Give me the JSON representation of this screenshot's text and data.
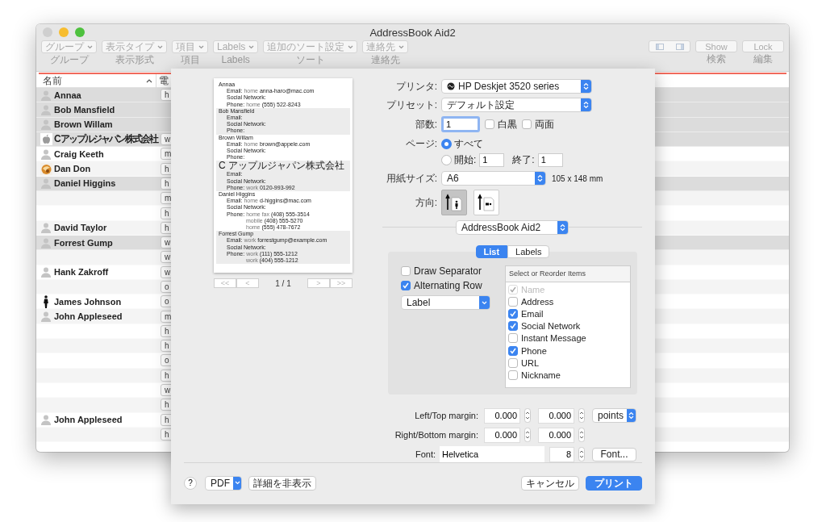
{
  "window": {
    "title": "AddressBook Aid2"
  },
  "toolbar": {
    "popups": [
      {
        "label": "グループ",
        "caption": "グループ",
        "disabled": true
      },
      {
        "label": "表示タイプ",
        "caption": "表示形式",
        "disabled": true
      },
      {
        "label": "項目",
        "caption": "項目",
        "disabled": true
      },
      {
        "label": "Labels",
        "caption": "Labels",
        "disabled": true
      },
      {
        "label": "追加のソート設定",
        "caption": "ソート",
        "disabled": true
      },
      {
        "label": "連絡先",
        "caption": "連絡先",
        "disabled": true
      }
    ],
    "buttons": [
      {
        "label": "Show",
        "caption": "検索",
        "disabled": true
      },
      {
        "label": "Lock",
        "caption": "編集",
        "disabled": true
      }
    ]
  },
  "table": {
    "columns": [
      "名前",
      "電"
    ],
    "rows": [
      {
        "name": "Annaa",
        "kind": "person",
        "highlighted": true,
        "phone": "h"
      },
      {
        "name": "Bob Mansfield",
        "kind": "person",
        "highlighted": true
      },
      {
        "name": "Brown Willam",
        "kind": "person",
        "highlighted": true
      },
      {
        "name": "C アップルジャパン株式会社",
        "kind": "company",
        "highlighted": true,
        "phone": "w"
      },
      {
        "name": "Craig Keeth",
        "kind": "person",
        "highlighted": false,
        "phone": "m"
      },
      {
        "name": "Dan Don",
        "highlighted": false,
        "phone": "h"
      },
      {
        "name": "Daniel Higgins",
        "kind": "person",
        "highlighted": true,
        "phone": "h"
      },
      {
        "highlighted": false,
        "phone": "m"
      },
      {
        "highlighted": false,
        "phone": "h"
      },
      {
        "name": "David Taylor",
        "kind": "person",
        "highlighted": false,
        "phone": "h"
      },
      {
        "name": "Forrest Gump",
        "kind": "person",
        "highlighted": true,
        "phone": "w"
      },
      {
        "highlighted": false,
        "phone": "w"
      },
      {
        "name": "Hank Zakroff",
        "kind": "person",
        "highlighted": false,
        "phone": "w"
      },
      {
        "highlighted": false,
        "phone": "o"
      },
      {
        "name": "James Johnson",
        "kind": "figure",
        "highlighted": false,
        "phone": "o"
      },
      {
        "name": "John Appleseed",
        "kind": "person",
        "highlighted": false,
        "phone": "m"
      },
      {
        "highlighted": false,
        "phone": "h"
      },
      {
        "highlighted": false,
        "phone": "h"
      },
      {
        "highlighted": false,
        "phone": "o"
      },
      {
        "highlighted": false,
        "phone": "h"
      },
      {
        "highlighted": false,
        "phone": "w"
      },
      {
        "highlighted": false,
        "phone": "h"
      },
      {
        "name": "John Appleseed",
        "kind": "person",
        "highlighted": false,
        "phone": "h"
      },
      {
        "highlighted": false,
        "phone": "h"
      }
    ]
  },
  "print": {
    "preview": [
      {
        "name": "Annaa",
        "shaded": false,
        "lines": [
          {
            "label": "Email:",
            "tag": "home",
            "value": "anna-haro@mac.com"
          },
          {
            "label": "Social Network:"
          },
          {
            "label": "Phone:",
            "tag": "home",
            "value": "(555) 522-8243"
          }
        ]
      },
      {
        "name": "Bob Mansfield",
        "shaded": true,
        "lines": [
          {
            "label": "Email:"
          },
          {
            "label": "Social Network:"
          },
          {
            "label": "Phone:"
          }
        ]
      },
      {
        "name": "Brown Willam",
        "shaded": false,
        "lines": [
          {
            "label": "Email:",
            "tag": "home",
            "value": "brown@appele.com"
          },
          {
            "label": "Social Network:"
          },
          {
            "label": "Phone:"
          }
        ]
      },
      {
        "name": "C アップルジャパン株式会社",
        "shaded": true,
        "lines": [
          {
            "label": "Email:"
          },
          {
            "label": "Social Network:"
          },
          {
            "label": "Phone:",
            "tag": "work",
            "value": "0120-993-992"
          }
        ]
      },
      {
        "name": "Daniel Higgins",
        "shaded": false,
        "lines": [
          {
            "label": "Email:",
            "tag": "home",
            "value": "d-higgins@mac.com"
          },
          {
            "label": "Social Network:"
          },
          {
            "label": "Phone:",
            "tag": "home fax",
            "value": "(408) 555-3514"
          },
          {
            "tag": "mobile",
            "value": "(408) 555-5270"
          },
          {
            "tag": "home",
            "value": "(555) 478-7672"
          }
        ]
      },
      {
        "name": "Forrest Gump",
        "shaded": true,
        "lines": [
          {
            "label": "Email:",
            "tag": "work",
            "value": "forrestgump@example.com"
          },
          {
            "label": "Social Network:"
          },
          {
            "label": "Phone:",
            "tag": "work",
            "value": "(111) 555-1212"
          },
          {
            "tag": "work",
            "value": "(404) 555-1212"
          }
        ]
      }
    ],
    "pager": {
      "first": "<<",
      "prev": "<",
      "page": "1 / 1",
      "next": ">",
      "last": ">>"
    },
    "printer": {
      "label": "プリンタ:",
      "value": "HP Deskjet 3520 series"
    },
    "preset": {
      "label": "プリセット:",
      "value": "デフォルト設定"
    },
    "copies": {
      "label": "部数:",
      "value": "1",
      "options": [
        {
          "label": "白黒",
          "checked": false
        },
        {
          "label": "両面",
          "checked": false
        }
      ]
    },
    "pages": {
      "label": "ページ:",
      "all": {
        "label": "すべて",
        "selected": true
      },
      "range": {
        "label": "開始:",
        "selected": false,
        "from": "1",
        "to_label": "終了:",
        "to": "1"
      }
    },
    "paper": {
      "label": "用紙サイズ:",
      "value": "A6",
      "size": "105 x 148 mm"
    },
    "orientation": {
      "label": "方向:",
      "options": [
        {
          "kind": "portrait",
          "selected": true
        },
        {
          "kind": "landscape",
          "selected": false
        }
      ]
    },
    "app_popup": "AddressBook Aid2",
    "tabs": [
      {
        "label": "List",
        "selected": true
      },
      {
        "label": "Labels",
        "selected": false
      }
    ],
    "options": [
      {
        "label": "Draw Separator",
        "checked": false
      },
      {
        "label": "Alternating Row",
        "checked": true
      }
    ],
    "style_popup": "Label",
    "items_header": "Select or Reorder Items",
    "items": [
      {
        "label": "Name",
        "checked": true,
        "disabled": true
      },
      {
        "label": "Address",
        "checked": false,
        "disabled": false
      },
      {
        "label": "Email",
        "checked": true,
        "disabled": false
      },
      {
        "label": "Social Network",
        "checked": true,
        "disabled": false
      },
      {
        "label": "Instant Message",
        "checked": false,
        "disabled": false
      },
      {
        "label": "Phone",
        "checked": true,
        "disabled": false
      },
      {
        "label": "URL",
        "checked": false,
        "disabled": false
      },
      {
        "label": "Nickname",
        "checked": false,
        "disabled": false
      }
    ],
    "margins": [
      {
        "label": "Left/Top margin:",
        "first": "0.000",
        "second": "0.000",
        "unit": "points"
      },
      {
        "label": "Right/Bottom margin:",
        "first": "0.000",
        "second": "0.000"
      }
    ],
    "font": {
      "label": "Font:",
      "value": "Helvetica",
      "size": "8",
      "button": "Font..."
    },
    "footer": {
      "help": "?",
      "pdf": "PDF",
      "details": "詳細を非表示",
      "cancel": "キャンセル",
      "print": "プリント"
    }
  }
}
